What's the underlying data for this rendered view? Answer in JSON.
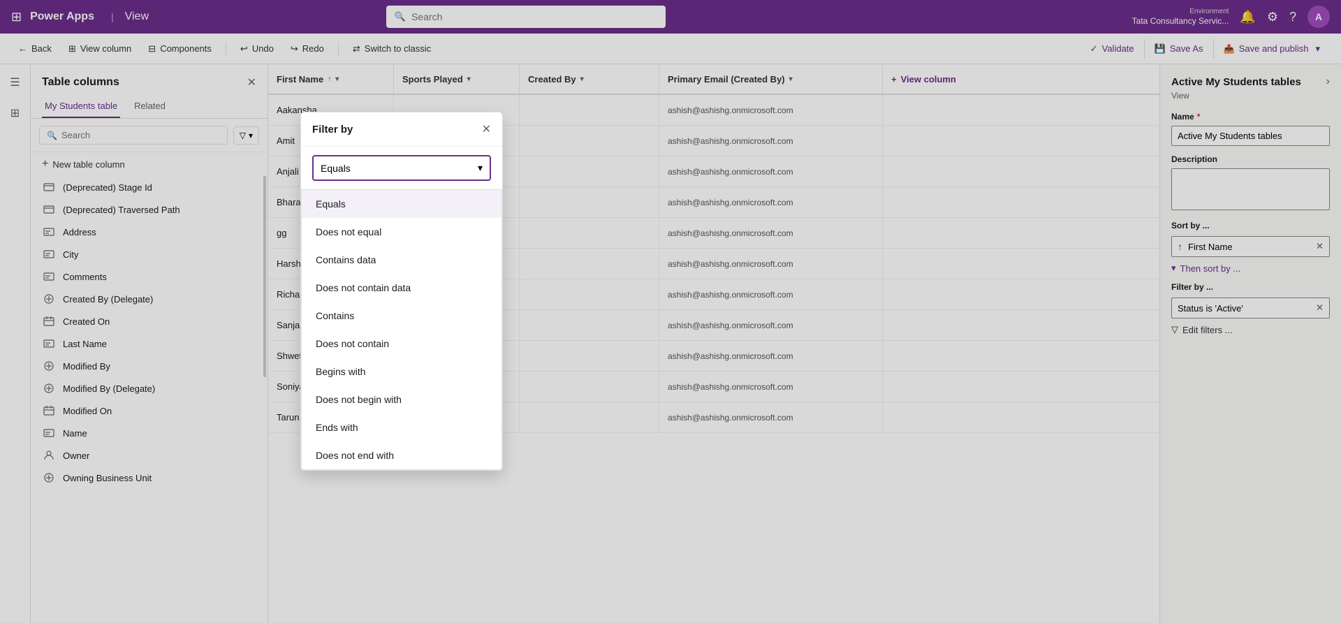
{
  "topnav": {
    "app_name": "Power Apps",
    "divider": "|",
    "view_label": "View",
    "search_placeholder": "Search",
    "environment_label": "Environment",
    "environment_name": "Tata Consultancy Servic...",
    "avatar_initials": "A"
  },
  "toolbar": {
    "back_label": "Back",
    "view_column_label": "View column",
    "components_label": "Components",
    "undo_label": "Undo",
    "redo_label": "Redo",
    "switch_classic_label": "Switch to classic",
    "validate_label": "Validate",
    "save_as_label": "Save As",
    "publish_label": "Save and publish"
  },
  "sidebar": {
    "title": "Table columns",
    "tab_my_students": "My Students table",
    "tab_related": "Related",
    "search_placeholder": "Search",
    "new_column_label": "New table column",
    "columns": [
      {
        "icon": "deprecated",
        "label": "(Deprecated) Stage Id"
      },
      {
        "icon": "deprecated",
        "label": "(Deprecated) Traversed Path"
      },
      {
        "icon": "text",
        "label": "Address"
      },
      {
        "icon": "text",
        "label": "City"
      },
      {
        "icon": "text",
        "label": "Comments"
      },
      {
        "icon": "lookup",
        "label": "Created By (Delegate)"
      },
      {
        "icon": "datetime",
        "label": "Created On"
      },
      {
        "icon": "text",
        "label": "Last Name"
      },
      {
        "icon": "lookup",
        "label": "Modified By"
      },
      {
        "icon": "lookup",
        "label": "Modified By (Delegate)"
      },
      {
        "icon": "datetime",
        "label": "Modified On"
      },
      {
        "icon": "text",
        "label": "Name"
      },
      {
        "icon": "user",
        "label": "Owner"
      },
      {
        "icon": "lookup",
        "label": "Owning Business Unit"
      }
    ]
  },
  "grid": {
    "columns": [
      {
        "label": "First Name",
        "has_sort": true,
        "has_filter": true
      },
      {
        "label": "Sports Played",
        "has_filter": true
      },
      {
        "label": "Created By",
        "has_filter": true
      },
      {
        "label": "Primary Email (Created By)",
        "has_filter": true
      }
    ],
    "add_column_label": "View column",
    "rows": [
      {
        "first_name": "Aakansha",
        "sports": "",
        "created_by": "",
        "email": "ashish@ashishg.onmicrosoft.com"
      },
      {
        "first_name": "Amit",
        "sports": "",
        "created_by": "",
        "email": "ashish@ashishg.onmicrosoft.com"
      },
      {
        "first_name": "Anjali",
        "sports": "",
        "created_by": "",
        "email": "ashish@ashishg.onmicrosoft.com"
      },
      {
        "first_name": "Bharat",
        "sports": "",
        "created_by": "",
        "email": "ashish@ashishg.onmicrosoft.com"
      },
      {
        "first_name": "gg",
        "sports": "",
        "created_by": "",
        "email": "ashish@ashishg.onmicrosoft.com"
      },
      {
        "first_name": "Harsha",
        "sports": "",
        "created_by": "",
        "email": "ashish@ashishg.onmicrosoft.com"
      },
      {
        "first_name": "Richa",
        "sports": "",
        "created_by": "",
        "email": "ashish@ashishg.onmicrosoft.com"
      },
      {
        "first_name": "Sanjana",
        "sports": "",
        "created_by": "",
        "email": "ashish@ashishg.onmicrosoft.com"
      },
      {
        "first_name": "Shweta",
        "sports": "",
        "created_by": "",
        "email": "ashish@ashishg.onmicrosoft.com"
      },
      {
        "first_name": "Soniya",
        "sports": "",
        "created_by": "",
        "email": "ashish@ashishg.onmicrosoft.com"
      },
      {
        "first_name": "Tarun",
        "sports": "",
        "created_by": "",
        "email": "ashish@ashishg.onmicrosoft.com"
      }
    ]
  },
  "right_panel": {
    "title": "Active My Students tables",
    "subtitle": "View",
    "name_label": "Name",
    "name_required": "*",
    "name_value": "Active My Students tables",
    "description_label": "Description",
    "description_value": "",
    "sort_label": "Sort by ...",
    "sort_field": "First Name",
    "then_sort_label": "Then sort by ...",
    "filter_label": "Filter by ...",
    "filter_value": "Status is 'Active'",
    "edit_filters_label": "Edit filters ..."
  },
  "filter_modal": {
    "title": "Filter by",
    "selected_option": "Equals",
    "options": [
      {
        "label": "Equals",
        "selected": true
      },
      {
        "label": "Does not equal",
        "selected": false
      },
      {
        "label": "Contains data",
        "selected": false
      },
      {
        "label": "Does not contain data",
        "selected": false
      },
      {
        "label": "Contains",
        "selected": false
      },
      {
        "label": "Does not contain",
        "selected": false
      },
      {
        "label": "Begins with",
        "selected": false
      },
      {
        "label": "Does not begin with",
        "selected": false
      },
      {
        "label": "Ends with",
        "selected": false
      },
      {
        "label": "Does not end with",
        "selected": false
      }
    ]
  }
}
